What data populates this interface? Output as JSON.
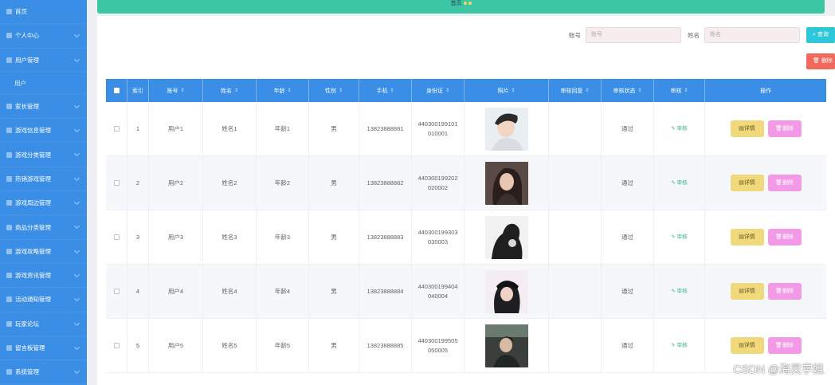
{
  "sidebar": {
    "items": [
      {
        "label": "首页",
        "chevron": false,
        "sub": false
      },
      {
        "label": "个人中心",
        "chevron": true,
        "sub": false
      },
      {
        "label": "用户管理",
        "chevron": true,
        "sub": false
      },
      {
        "label": "用户",
        "chevron": false,
        "sub": true
      },
      {
        "label": "家长管理",
        "chevron": true,
        "sub": false
      },
      {
        "label": "游戏信息管理",
        "chevron": true,
        "sub": false
      },
      {
        "label": "游戏分类管理",
        "chevron": true,
        "sub": false
      },
      {
        "label": "热销游戏管理",
        "chevron": true,
        "sub": false
      },
      {
        "label": "游戏周边管理",
        "chevron": true,
        "sub": false
      },
      {
        "label": "商品分类管理",
        "chevron": true,
        "sub": false
      },
      {
        "label": "游戏攻略管理",
        "chevron": true,
        "sub": false
      },
      {
        "label": "游戏资讯管理",
        "chevron": true,
        "sub": false
      },
      {
        "label": "活动通知管理",
        "chevron": true,
        "sub": false
      },
      {
        "label": "玩家论坛",
        "chevron": true,
        "sub": false
      },
      {
        "label": "留言板管理",
        "chevron": true,
        "sub": false
      },
      {
        "label": "系统管理",
        "chevron": true,
        "sub": false
      }
    ]
  },
  "topbar": {
    "crumb": "首页"
  },
  "search": {
    "account_label": "账号",
    "account_placeholder": "账号",
    "name_label": "姓名",
    "name_placeholder": "姓名",
    "query_button": "查询",
    "delete_button": "删除"
  },
  "table": {
    "columns": [
      "索引",
      "账号",
      "姓名",
      "年龄",
      "性别",
      "手机",
      "身份证",
      "照片",
      "审核回复",
      "审核状态",
      "审核",
      "操作"
    ],
    "sortable": [
      false,
      true,
      true,
      true,
      true,
      true,
      true,
      true,
      true,
      true,
      true,
      false
    ],
    "rows": [
      {
        "index": "1",
        "account": "用户1",
        "name": "姓名1",
        "age": "年龄1",
        "gender": "男",
        "phone": "13823888881",
        "id_line1": "440300199101",
        "id_line2": "010001",
        "reply": "",
        "status": "通过",
        "audit": "审核"
      },
      {
        "index": "2",
        "account": "用户2",
        "name": "姓名2",
        "age": "年龄2",
        "gender": "男",
        "phone": "13823888882",
        "id_line1": "440300199202",
        "id_line2": "020002",
        "reply": "",
        "status": "通过",
        "audit": "审核"
      },
      {
        "index": "3",
        "account": "用户3",
        "name": "姓名3",
        "age": "年龄3",
        "gender": "男",
        "phone": "13823888883",
        "id_line1": "440300199303",
        "id_line2": "030003",
        "reply": "",
        "status": "通过",
        "audit": "审核"
      },
      {
        "index": "4",
        "account": "用户4",
        "name": "姓名4",
        "age": "年龄4",
        "gender": "男",
        "phone": "13823888884",
        "id_line1": "440300199404",
        "id_line2": "040004",
        "reply": "",
        "status": "通过",
        "audit": "审核"
      },
      {
        "index": "5",
        "account": "用户5",
        "name": "姓名5",
        "age": "年龄5",
        "gender": "男",
        "phone": "13823888885",
        "id_line1": "440300199505",
        "id_line2": "050005",
        "reply": "",
        "status": "通过",
        "audit": "审核"
      }
    ],
    "detail_button": "详情",
    "delete_button": "删除"
  },
  "watermark": "CSDN @海灵学姐",
  "colors": {
    "sidebar": "#3a8ee6",
    "topbar": "#3cc6a4",
    "query": "#2ec7d9",
    "danger": "#f0695a",
    "detail": "#f0d97c",
    "delete": "#f29ae6"
  }
}
